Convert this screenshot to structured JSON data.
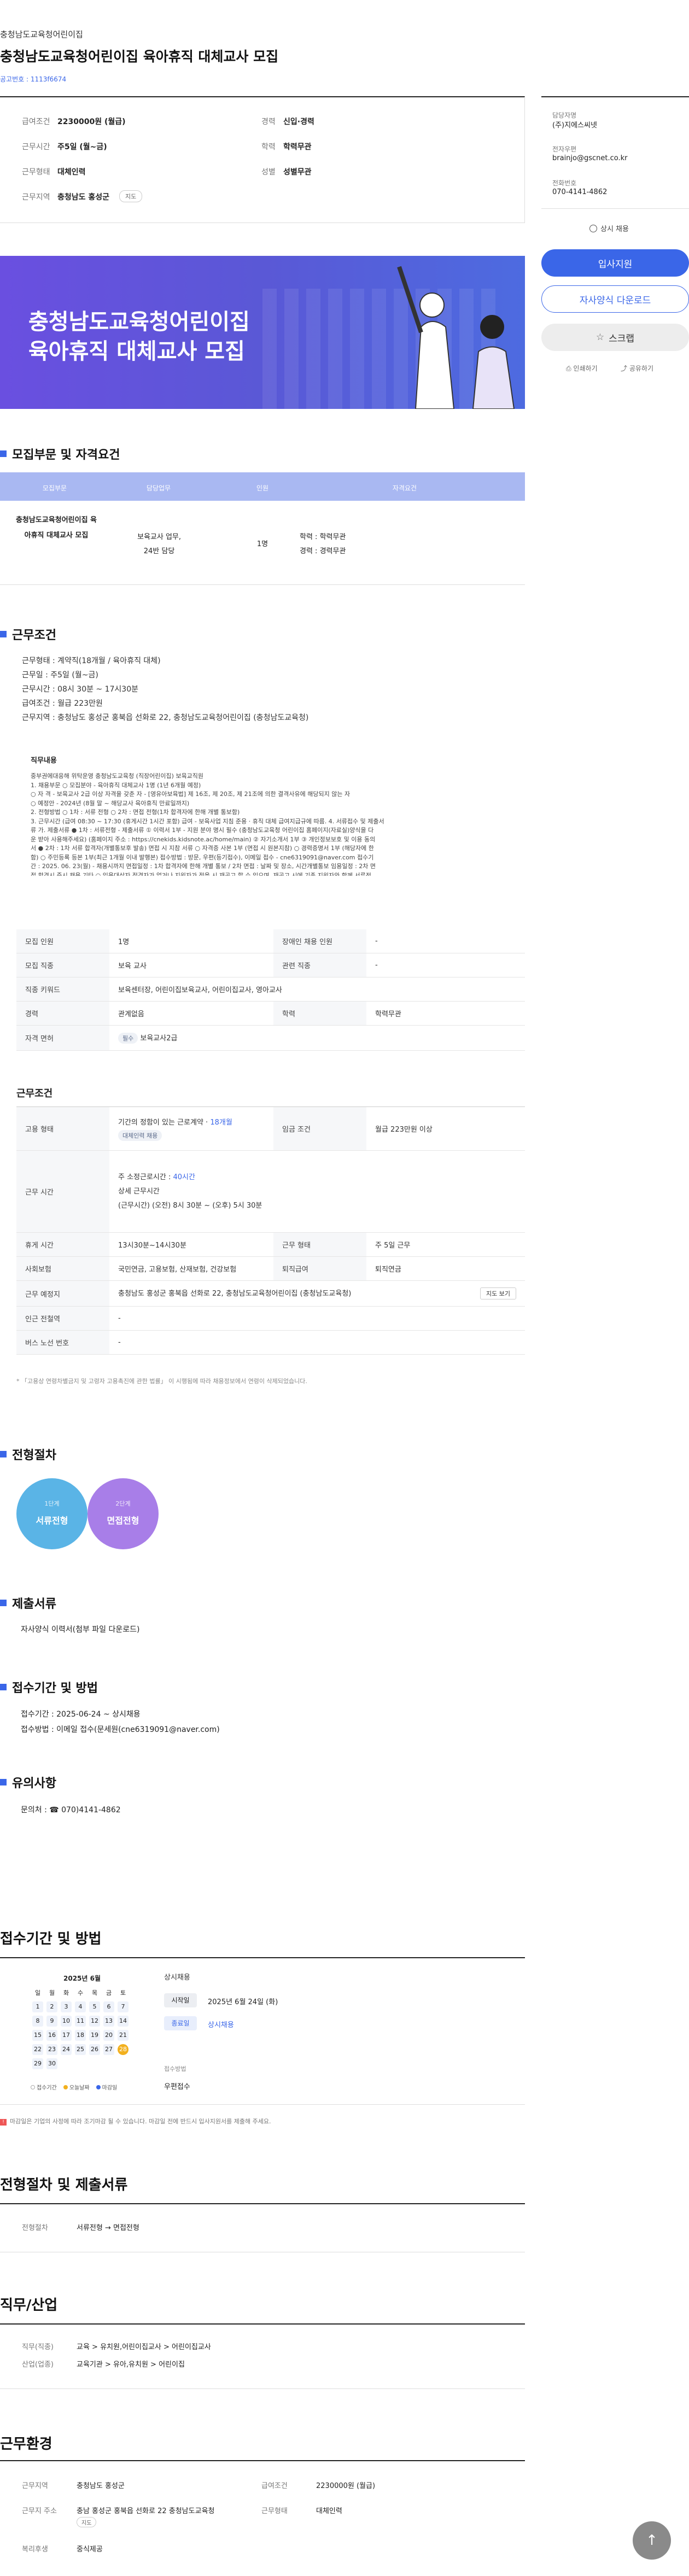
{
  "header": {
    "org_name": "충청남도교육청어린이집",
    "title": "충청남도교육청어린이집 육아휴직 대체교사 모집",
    "notice_no": "공고번호 : 1113f6674"
  },
  "summary": {
    "salary_label": "급여조건",
    "salary": "2230000원 (월급)",
    "career_label": "경력",
    "career": "신입·경력",
    "workdays_label": "근무시간",
    "workdays": "주5일 (월~금)",
    "edu_label": "학력",
    "edu": "학력무관",
    "type_label": "근무형태",
    "type": "대체인력",
    "gender_label": "성별",
    "gender": "성별무관",
    "area_label": "근무지역",
    "area": "충청남도 홍성군",
    "map_label": "지도"
  },
  "contact": {
    "manager_label": "담당자명",
    "manager": "(주)지에스씨넷",
    "email_label": "전자우편",
    "email": "brainjo@gscnet.co.kr",
    "phone_label": "전화번호",
    "phone": "070-4141-4862"
  },
  "side": {
    "always_hire": "상시 채용",
    "apply": "입사지원",
    "download": "자사양식 다운로드",
    "scrap": "스크랩",
    "print": "인쇄하기",
    "share": "공유하기"
  },
  "banner": {
    "line1": "충청남도교육청어린이집",
    "line2": "육아휴직 대체교사 모집"
  },
  "recruit": {
    "section_title": "모집부문 및 자격요건",
    "headers": [
      "모집부문",
      "담당업무",
      "인원",
      "자격요건"
    ],
    "dept": "충청남도교육청어린이집 육아휴직 대체교사 모집",
    "duty1": "보육교사 업무,",
    "duty2": "24반 담당",
    "count": "1명",
    "req1": "학력 : 학력무관",
    "req2": "경력 : 경력무관"
  },
  "work": {
    "section_title": "근무조건",
    "lines": [
      "근무형태 : 계약직(18개월 / 육아휴직 대체)",
      "근무일 : 주5일 (월~금)",
      "근무시간 : 08시 30분 ~ 17시30분",
      "급여조건 : 월급 223만원",
      "근무지역 : 충청남도 홍성군 홍북읍 선화로 22, 충청남도교육청어린이집 (충청남도교육청)"
    ],
    "detail_label": "직무내용",
    "detail": "중부권에대응해 위탁운영 충청남도교육청 (직장어린이집) 보육교직원\n1. 채용부문 ○ 모집분야 - 육아휴직 대체교사 1명 (1년 6개월 예정)\n○ 자 격 - 보육교사 2급 이상 자격을 갖춘 자 - [영유아보육법] 제 16조, 제 20조, 제 21조에 의한 결격사유에 해당되지 않는 자\n○ 예정안 - 2024년 (8월 말 ~ 해당교사 육아휴직 만료일까지)\n2. 전형방법 ○ 1차 : 서류 전형 ○ 2차 : 면접 전형(1차 합격자에 한해 개별 통보함)\n3. 근무시간 (급여 08:30 ~ 17:30 (휴게시간 1시간 포함) 급여 - 보육사업 지침 준용 · 휴직 대체 급여지급규에 따름. 4. 서류접수 및 제출서\n류 가. 제출서류 ● 1차 : 서류전형 - 제출서류 ① 이력서 1부 - 지원 분야 명시 필수 (충청남도교육청 어린이집 홈페이지(자료실)양식을 다\n운 받아 사용해주세요) (홈페이지 주소 : https://cnekids.kidsnote.ac/home/main) ② 자기소개서 1부 ③ 개인정보보호 및 이용 동의\n서 ● 2차 : 1차 서류 합격자(개별통보후 발송) 면접 시 지참 서류 ○ 자격증 사본 1부 (면접 시 원본지참) ○ 경력증명서 1부 (해당자에 한\n함) ○ 주민등록 등본 1부(최근 1개월 이내 발행본) 접수방법 : 방문, 우편(등기접수), 이메일 접수 - cne6319091@naver.com 접수기\n간 : 2025. 06. 23(월) - 채용시까지 면접일정 : 1차 합격자에 한해 개별 통보 / 2차 면접 : 날짜 및 장소, 시간개별통보 임용일정 : 2차 면\n접 합격시 즉시 채용 기타 ○ 임용대상자 적격자가 없거나 지원자가 적을 시 재공고 할 수 있으며, 재공고 시에 기존 지원자와 함께 서류전\n형 심사를 함. ○ 제출된 서류는 일체 반환하지 않으며 채용 목적 외에는 사용하지 않음. 임용 후 서류 등이 허위로 판명되면 임용을 취\n소 할 수 있음. (성범죄/아동학대 경력 조회 및 건강검진결과) 부적격 판정자는 합격이 취소됨"
  },
  "jobtable": {
    "count_label": "모집 인원",
    "count": "1명",
    "disability_label": "장애인 채용 인원",
    "disability": "-",
    "job_label": "모집 직종",
    "job": "보육 교사",
    "rel_label": "관련 직종",
    "rel": "-",
    "kw_label": "직종 키워드",
    "kw": "보육센터장, 어린이집보육교사, 어린이집교사, 영아교사",
    "career_label": "경력",
    "career": "관계없음",
    "edu_label": "학력",
    "edu": "학력무관",
    "cert_label": "자격 면허",
    "cert_badge": "필수",
    "cert": "보육교사2급"
  },
  "cond": {
    "section_title": "근무조건",
    "hire_label": "고용 형태",
    "hire": "기간의 정함이 있는 근로계약 · ",
    "hire_months": "18개월",
    "hire_badge": "대체인력 채용",
    "pay_label": "임금 조건",
    "pay": "월급 223만원 이상",
    "time_label": "근무 시간",
    "time1": "주 소정근로시간 : ",
    "time1b": "40시간",
    "time2": "상세 근무시간",
    "time3": "(근무시간) (오전) 8시 30분 ~ (오후) 5시 30분",
    "break_label": "휴게 시간",
    "break": "13시30분~14시30분",
    "form_label": "근무 형태",
    "form": "주 5일 근무",
    "ins_label": "사회보험",
    "ins": "국민연금, 고용보험, 산재보험, 건강보험",
    "ret_label": "퇴직급여",
    "ret": "퇴직연금",
    "place_label": "근무 예정지",
    "place": "충청남도 홍성군 홍북읍 선화로 22, 충청남도교육청어린이집 (충청남도교육청)",
    "map_btn": "지도 보기",
    "station_label": "인근 전철역",
    "station": "-",
    "bus_label": "버스 노선 번호",
    "bus": "-",
    "note": "* 「고용상 연령차별금지 및 고령자 고용촉진에 관한 법률」 이 시행됨에 따라 채용정보에서 연령이 삭제되었습니다."
  },
  "process": {
    "section_title": "전형절차",
    "s1_step": "1단계",
    "s1": "서류전형",
    "s2_step": "2단계",
    "s2": "면접전형"
  },
  "docs": {
    "section_title": "제출서류",
    "text": "자사양식 이력서(첨부 파일 다운로드)"
  },
  "period": {
    "section_title": "접수기간 및 방법",
    "l1": "접수기간 : 2025-06-24 ~ 상시채용",
    "l2": "접수방법 : 이메일 접수(문세원(cne6319091@naver.com)"
  },
  "caution": {
    "section_title": "유의사항",
    "text": "문의처 : ☎ 070)4141-4862"
  },
  "period2": {
    "title": "접수기간 및 방법",
    "cal_title": "2025년 6월",
    "weekdays": [
      "일",
      "월",
      "화",
      "수",
      "목",
      "금",
      "토"
    ],
    "weeks": [
      [
        "1",
        "2",
        "3",
        "4",
        "5",
        "6",
        "7"
      ],
      [
        "8",
        "9",
        "10",
        "11",
        "12",
        "13",
        "14"
      ],
      [
        "15",
        "16",
        "17",
        "18",
        "19",
        "20",
        "21"
      ],
      [
        "22",
        "23",
        "24",
        "25",
        "26",
        "27",
        "28"
      ],
      [
        "29",
        "30",
        "",
        "",
        "",
        "",
        ""
      ]
    ],
    "legend1": "접수기간",
    "legend2": "오늘날짜",
    "legend3": "마감일",
    "always": "상시채용",
    "start_label": "시작일",
    "start": "2025년 6월 24일 (화)",
    "end_label": "종료일",
    "end": "상시채용",
    "method_label": "접수방법",
    "method": "우편접수",
    "warn": "마감일은 기업의 사정에 따라 조기마감 될 수 있습니다. 마감일 전에 반드시 입사지원서를 제출해 주세요."
  },
  "proc2": {
    "title": "전형절차 및 제출서류",
    "label": "전형절차",
    "value": "서류전형 → 면접전형"
  },
  "industry": {
    "title": "직무/산업",
    "job_label": "직무(직종)",
    "job": "교육 > 유치원,어린이집교사 > 어린이집교사",
    "ind_label": "산업(업종)",
    "ind": "교육기관 > 유아,유치원 > 어린이집"
  },
  "env": {
    "title": "근무환경",
    "area_label": "근무지역",
    "area": "충청남도 홍성군",
    "pay_label": "급여조건",
    "pay": "2230000원 (월급)",
    "addr_label": "근무지 주소",
    "addr": "충남 홍성군 홍북읍 선화로 22 충청남도교육청",
    "addr_badge": "지도",
    "type_label": "근무형태",
    "type": "대체인력",
    "welfare_label": "복리후생",
    "welfare": "중식제공"
  },
  "colors": {
    "accent": "#3a66e8",
    "purple": "#6b4fd8",
    "teal": "#3aa7dd",
    "header_row": "#a9b8f2"
  }
}
